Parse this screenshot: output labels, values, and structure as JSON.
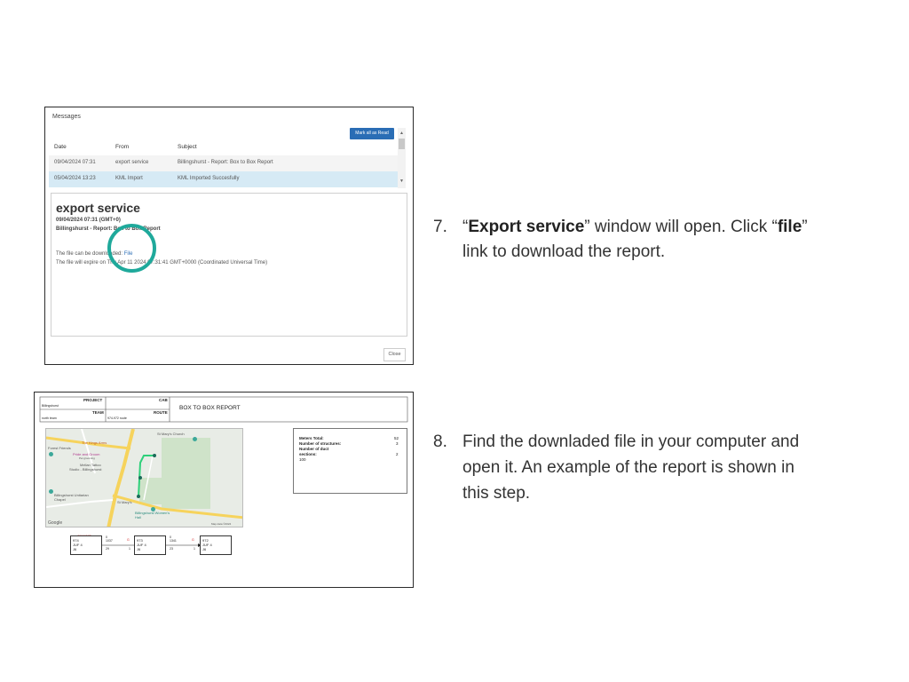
{
  "messages_window": {
    "title": "Messages",
    "mark_all_read_label": "Mark all as Read",
    "columns": [
      "Date",
      "From",
      "Subject"
    ],
    "rows": [
      {
        "date": "09/04/2024 07:31",
        "from": "export service",
        "subject": "Billingshurst  - Report: Box to Box Report"
      },
      {
        "date": "05/04/2024 13:23",
        "from": "KML Import",
        "subject": "KML Imported Succesfully"
      }
    ],
    "detail": {
      "heading": "export service",
      "datetime": "09/04/2024 07:31 (GMT+0)",
      "subject": "Billingshurst  - Report: Box to Box Report",
      "download_text": "The file can be downloaded:",
      "file_link": "File",
      "expiry_text": "The file will expire on Thu Apr 11 2024 07:31:41 GMT+0000 (Coordinated Universal Time)"
    },
    "close_label": "Close",
    "highlight_color": "#1fa99b"
  },
  "report": {
    "project_label": "PROJECT",
    "project_value": "Billingshurst",
    "cab_label": "CAB",
    "team_label": "TEAM",
    "team_value": "north team",
    "route_label": "ROUTE",
    "route_value": "974-972 route",
    "title": "BOX TO BOX REPORT",
    "map": {
      "places": [
        "St Mary's Church",
        "The Kings Arms",
        "Forest Friends",
        "Pride and Groom",
        "Pet grooming",
        "Mellan Tattoo",
        "Studio - Billingshurst",
        "Billingshurst Unitarian Chapel",
        "St Mary's",
        "Billingshurst Women's Hall",
        "Google",
        "Map data ©2024"
      ]
    },
    "stats": {
      "meters_total_label": "Meters Total:",
      "meters_total_value": "52",
      "structures_label": "Number of structures:",
      "structures_value": "3",
      "duct_label_1": "Number of duct",
      "duct_label_2": "sections:",
      "duct_value": "2",
      "extra_value": "100"
    },
    "diagram": {
      "top_label": "C011375",
      "boxes": [
        {
          "id": "974",
          "type": "JUF 4",
          "code": "J6"
        },
        {
          "id": "973",
          "type": "JUF 4",
          "code": "J6"
        },
        {
          "id": "972",
          "type": "JUF 4",
          "code": "J6"
        }
      ],
      "links": [
        {
          "top": "0",
          "mid": "1037",
          "len": "29",
          "count": "1",
          "flag": "G"
        },
        {
          "top": "0",
          "mid": "1341",
          "len": "23",
          "count": "1",
          "flag": "G"
        }
      ]
    }
  },
  "steps": [
    {
      "number": "7.",
      "q1": "“",
      "bold1": "Export service",
      "text1": "” window will open. Click “",
      "bold2": "file",
      "text2": "”",
      "line2": "link to download the report."
    },
    {
      "number": "8.",
      "line1": "Find the downladed file in your computer and",
      "line2": "open it. An example of the report is shown in",
      "line3": "this step."
    }
  ]
}
